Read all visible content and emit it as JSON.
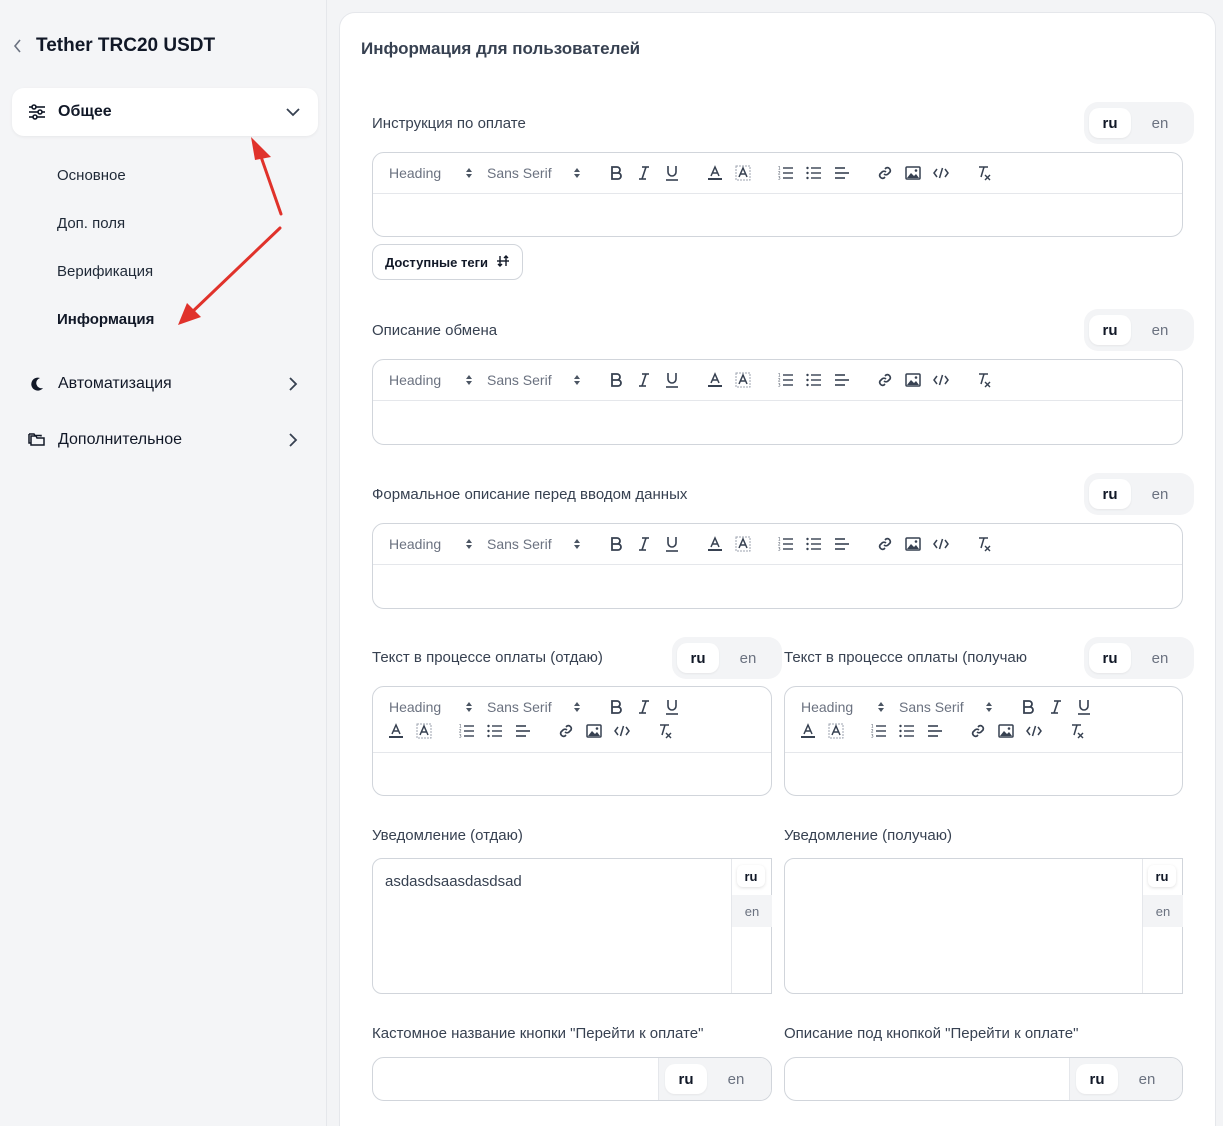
{
  "sidebar": {
    "title": "Tether TRC20 USDT",
    "groups": [
      {
        "label": "Общее",
        "icon": "sliders-icon",
        "expanded": true
      },
      {
        "label": "Автоматизация",
        "icon": "moon-icon",
        "expanded": false
      },
      {
        "label": "Дополнительное",
        "icon": "folders-icon",
        "expanded": false
      }
    ],
    "subitems": [
      "Основное",
      "Доп. поля",
      "Верификация",
      "Информация"
    ],
    "active_subitem": "Информация"
  },
  "main": {
    "title": "Информация для пользователей",
    "lang": {
      "ru": "ru",
      "en": "en"
    },
    "toolbar": {
      "heading": "Heading",
      "font": "Sans Serif"
    },
    "fields": {
      "payment_instruction": "Инструкция по оплате",
      "exchange_description": "Описание обмена",
      "formal_description": "Формальное описание перед вводом данных",
      "payment_text_give": "Текст в процессе оплаты (отдаю)",
      "payment_text_receive": "Текст в процессе оплаты (получаю",
      "notify_give": "Уведомление (отдаю)",
      "notify_receive": "Уведомление (получаю)",
      "custom_button_name": "Кастомное название кнопки \"Перейти к оплате\"",
      "button_description": "Описание под кнопкой \"Перейти к оплате\""
    },
    "available_tags": "Доступные теги",
    "notify_give_value": "asdasdsaasdasdsad",
    "notify_receive_value": ""
  },
  "colors": {
    "arrow": "#e0322b",
    "accent_bg": "#f3f4f6"
  }
}
